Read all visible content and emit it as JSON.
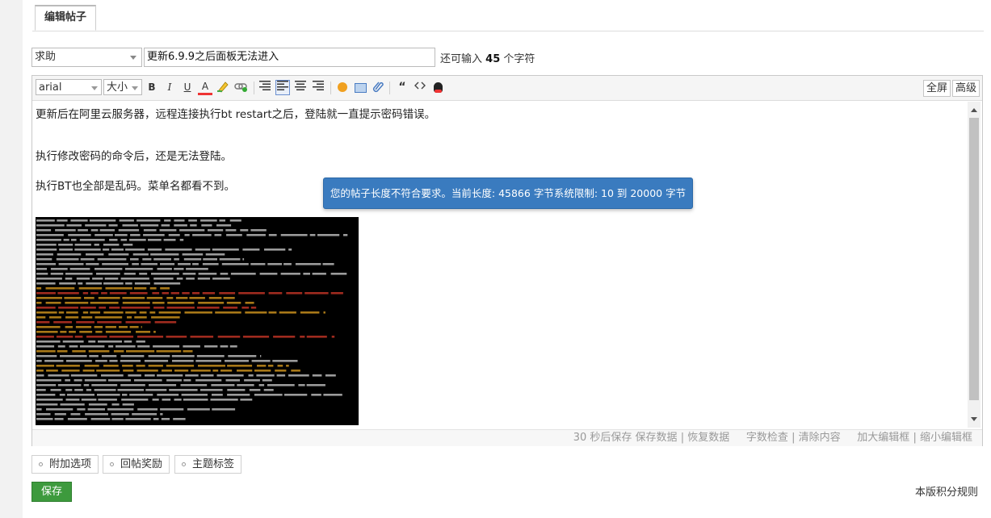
{
  "tab": {
    "label": "编辑帖子"
  },
  "post": {
    "type": "求助",
    "title": "更新6.9.9之后面板无法进入",
    "remain_prefix": "还可输入",
    "remain_count": "45",
    "remain_suffix": "个字符"
  },
  "toolbar": {
    "font": "arial",
    "size": "大小",
    "bold": "B",
    "italic": "I",
    "underline": "U",
    "color": "A",
    "fullscreen": "全屏",
    "advanced": "高级"
  },
  "content": {
    "lines": [
      "更新后在阿里云服务器，远程连接执行bt restart之后，登陆就一直提示密码错误。",
      "执行修改密码的命令后，还是无法登陆。",
      "执行BT也全部是乱码。菜单名都看不到。"
    ]
  },
  "tooltip": {
    "text": "您的帖子长度不符合要求。当前长度: 45866 字节系统限制: 10 到 20000 字节"
  },
  "status": {
    "autosave": "30 秒后保存",
    "save_data": "保存数据",
    "restore_data": "恢复数据",
    "word_check": "字数检查",
    "clear": "清除内容",
    "enlarge": "加大编辑框",
    "shrink": "缩小编辑框"
  },
  "options": {
    "extra": "附加选项",
    "reward": "回帖奖励",
    "tags": "主题标签"
  },
  "save_label": "保存",
  "rules_label": "本版积分规则",
  "colors": {
    "accent": "#3a7bbf",
    "save": "#3d9a3d"
  }
}
